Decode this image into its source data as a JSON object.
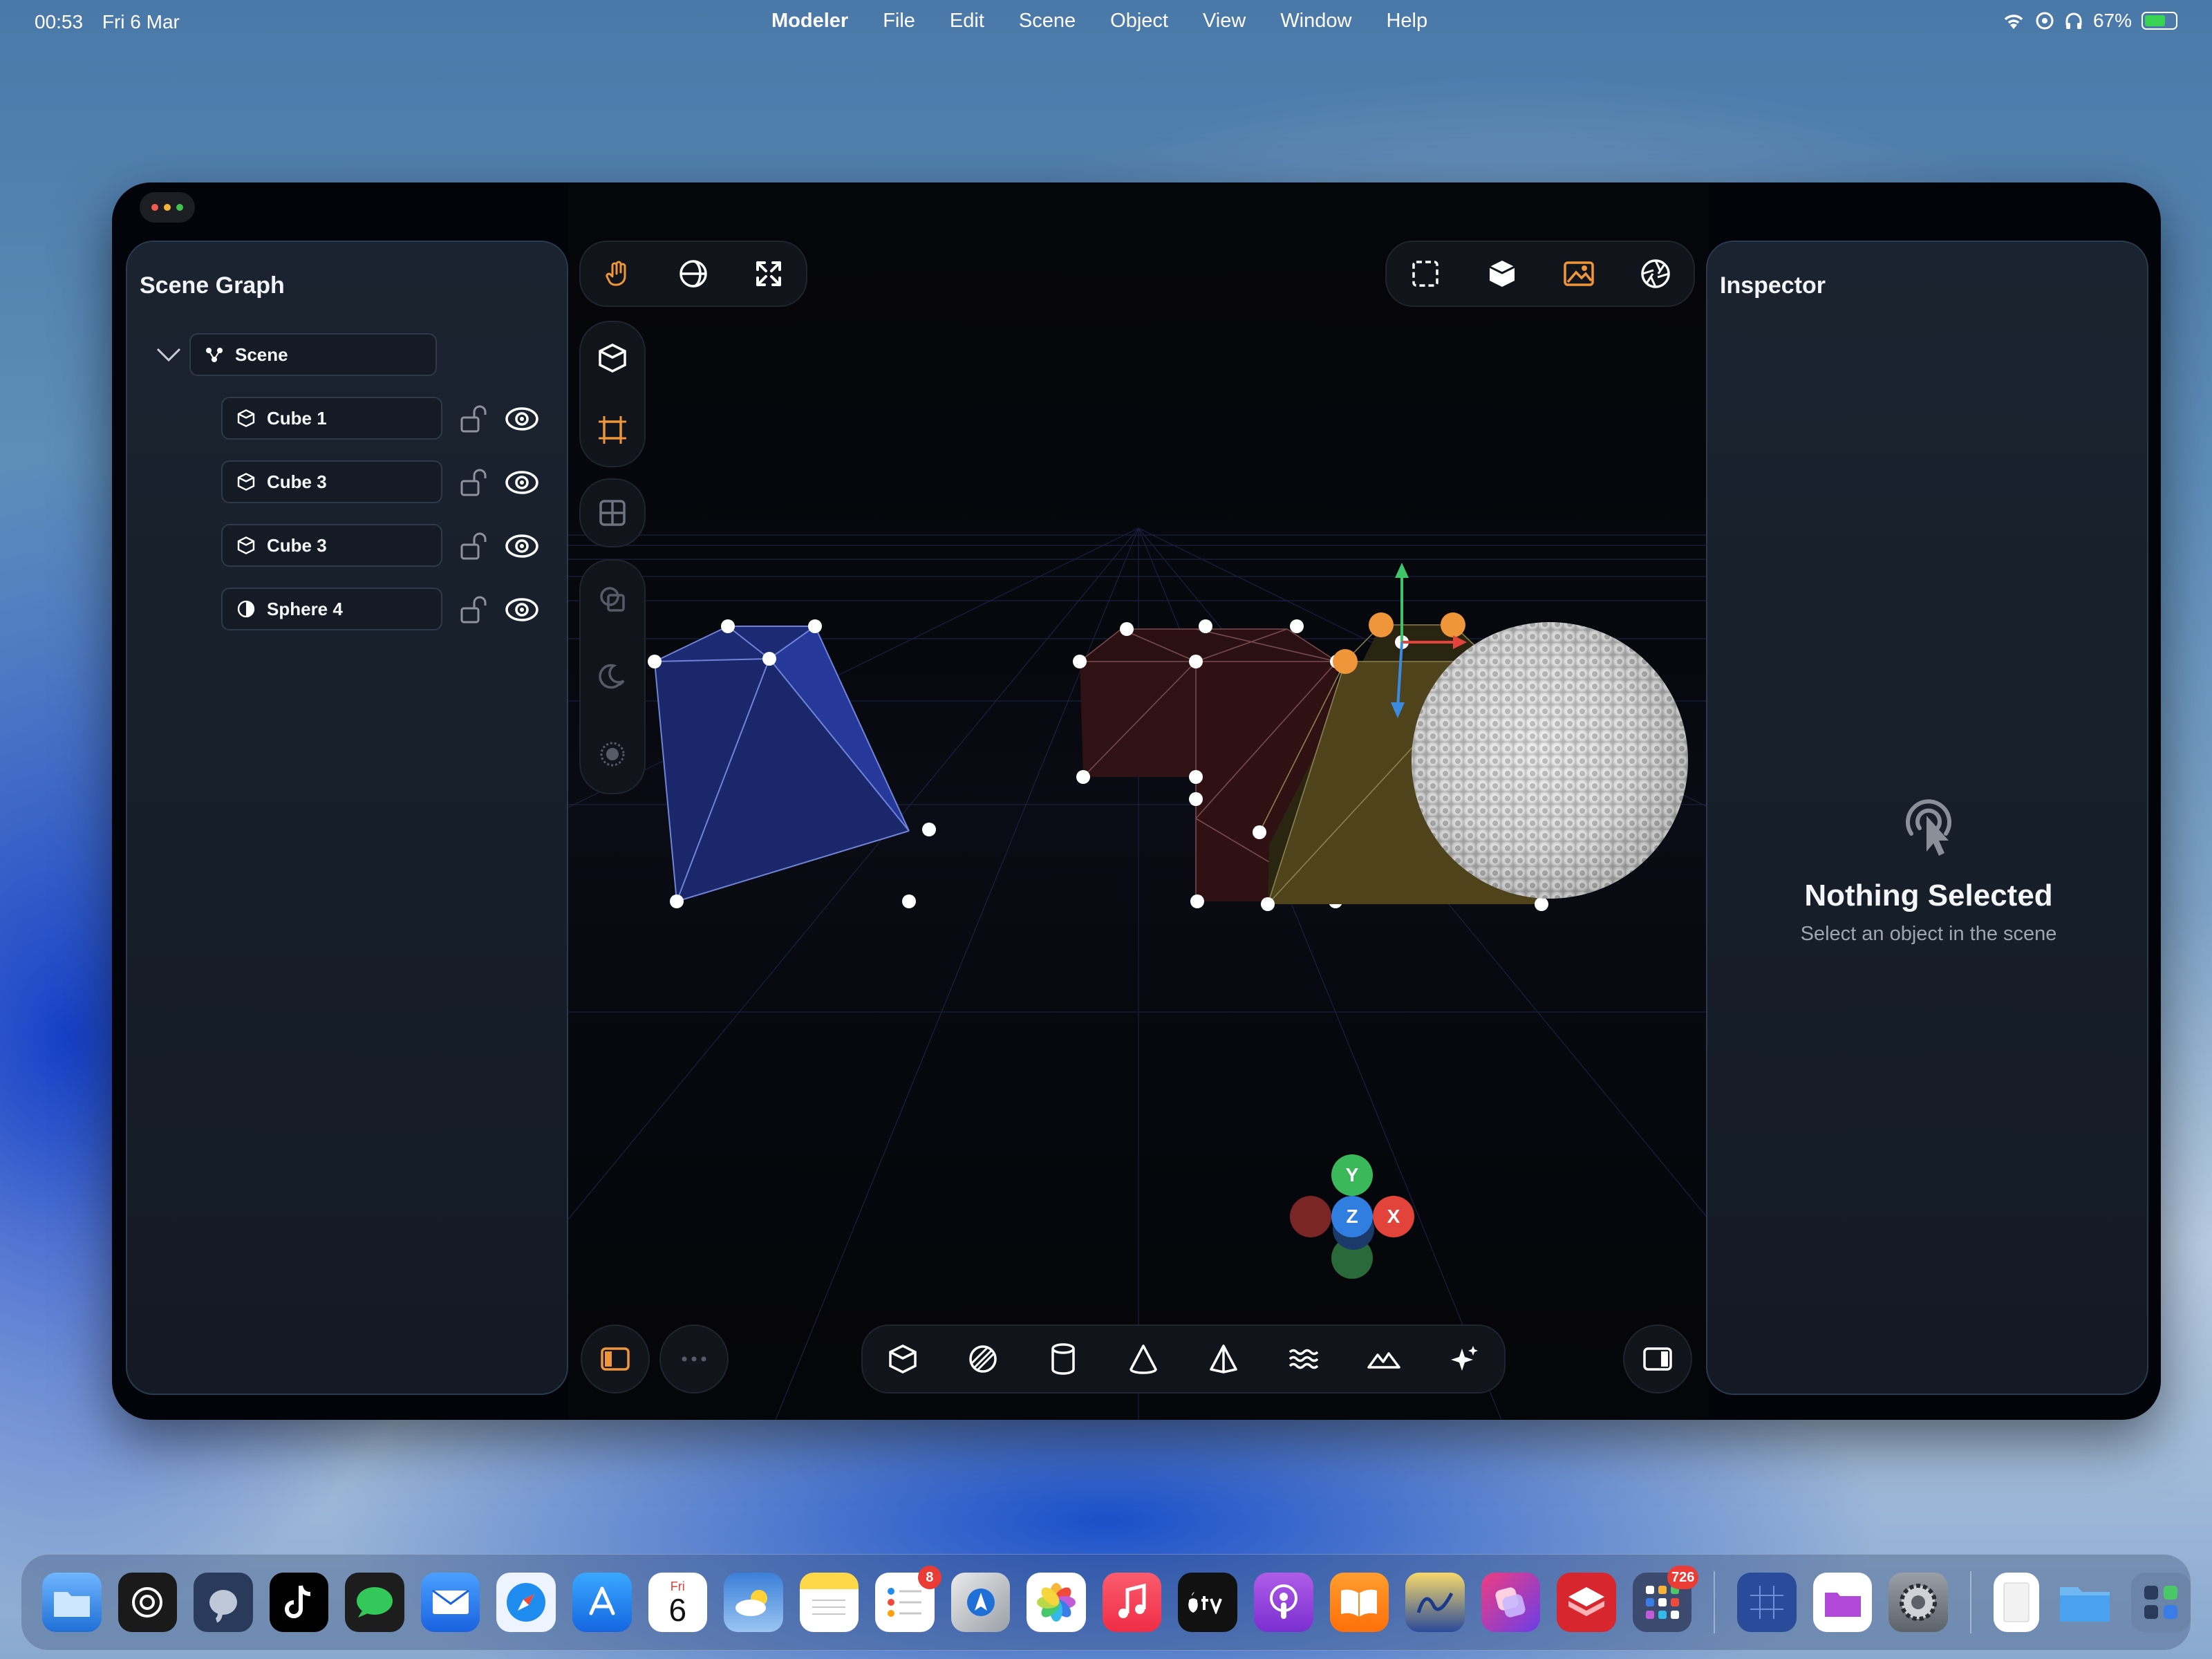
{
  "menubar": {
    "time": "00:53",
    "date": "Fri 6 Mar",
    "app_name": "Modeler",
    "menus": [
      "File",
      "Edit",
      "Scene",
      "Object",
      "View",
      "Window",
      "Help"
    ],
    "battery": "67%"
  },
  "scene_graph": {
    "title": "Scene Graph",
    "root": "Scene",
    "items": [
      {
        "label": "Cube 1",
        "icon": "cube-icon"
      },
      {
        "label": "Cube 3",
        "icon": "cube-icon"
      },
      {
        "label": "Cube 3",
        "icon": "cube-icon"
      },
      {
        "label": "Sphere 4",
        "icon": "sphere-icon"
      }
    ]
  },
  "inspector": {
    "title": "Inspector",
    "empty_title": "Nothing Selected",
    "empty_subtitle": "Select an object in the scene"
  },
  "gizmo": {
    "y": "Y",
    "x": "X",
    "z": "Z"
  },
  "dock": {
    "calendar_day": "Fri",
    "calendar_date": "6",
    "reminders_badge": "8",
    "launchpad_badge": "726"
  },
  "colors": {
    "accent": "#f0963a",
    "cube_blue": "#1f2f7a",
    "cube_red": "#2c1113",
    "cube_yellow": "#4a4019"
  }
}
